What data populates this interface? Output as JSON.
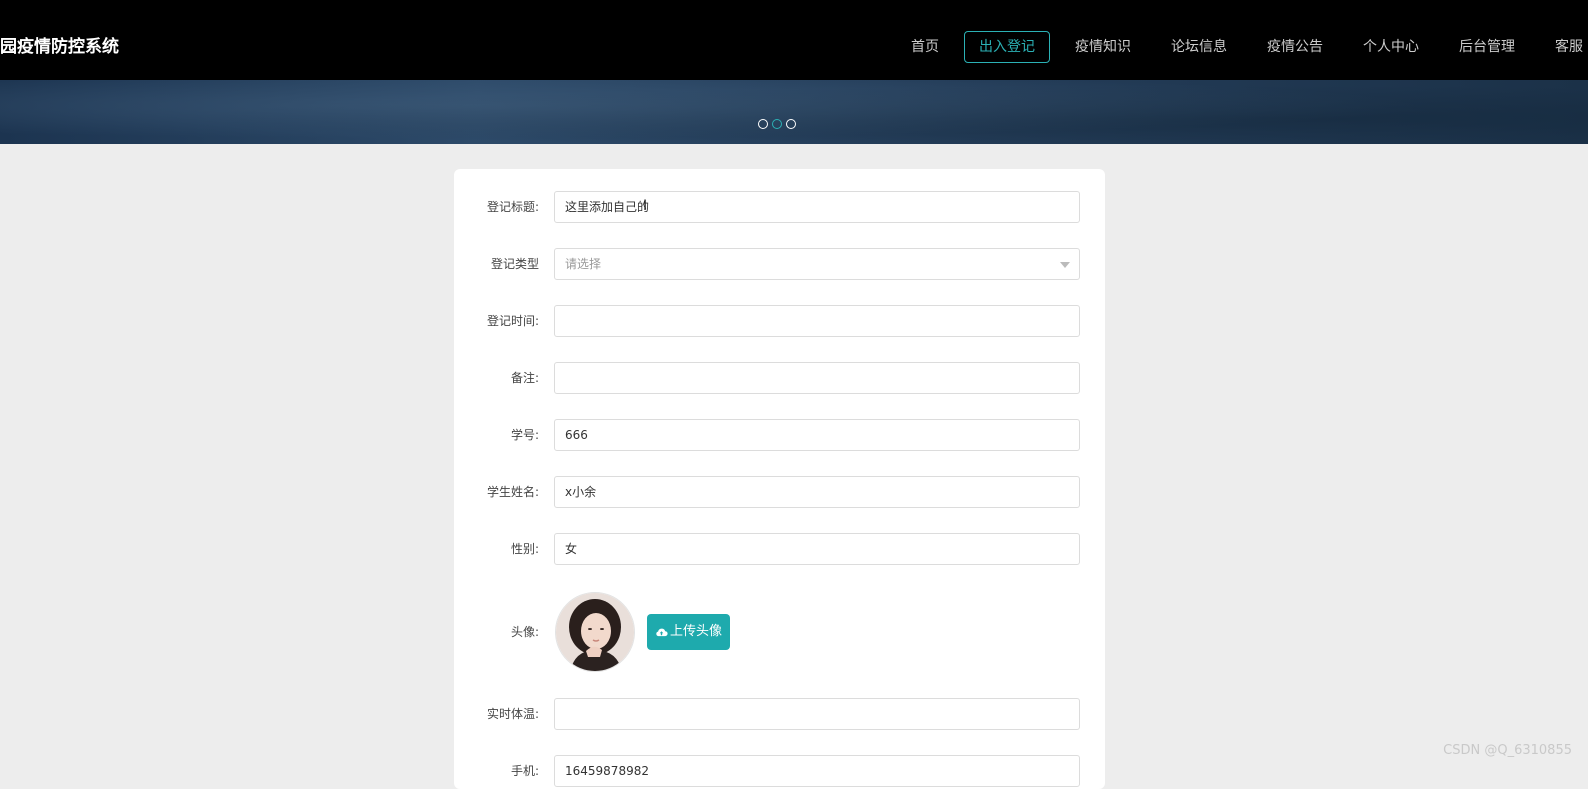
{
  "header": {
    "site_title": "园疫情防控系统",
    "nav": [
      {
        "label": "首页",
        "active": false
      },
      {
        "label": "出入登记",
        "active": true
      },
      {
        "label": "疫情知识",
        "active": false
      },
      {
        "label": "论坛信息",
        "active": false
      },
      {
        "label": "疫情公告",
        "active": false
      },
      {
        "label": "个人中心",
        "active": false
      },
      {
        "label": "后台管理",
        "active": false
      },
      {
        "label": "客服",
        "active": false
      }
    ],
    "accent_color": "#2bb1b5"
  },
  "carousel": {
    "slide_count": 3,
    "active_index": 1
  },
  "form": {
    "title_label": "登记标题:",
    "title_value": "这里添加自己的",
    "type_label": "登记类型",
    "type_placeholder": "请选择",
    "time_label": "登记时间:",
    "time_value": "",
    "remark_label": "备注:",
    "remark_value": "",
    "student_id_label": "学号:",
    "student_id_value": "666",
    "student_name_label": "学生姓名:",
    "student_name_value": "x小余",
    "gender_label": "性别:",
    "gender_value": "女",
    "avatar_label": "头像:",
    "upload_label": "上传头像",
    "temperature_label": "实时体温:",
    "temperature_value": "",
    "phone_label": "手机:",
    "phone_value": "16459878982",
    "button_color": "#1eaaad"
  },
  "watermark": "CSDN @Q_6310855"
}
